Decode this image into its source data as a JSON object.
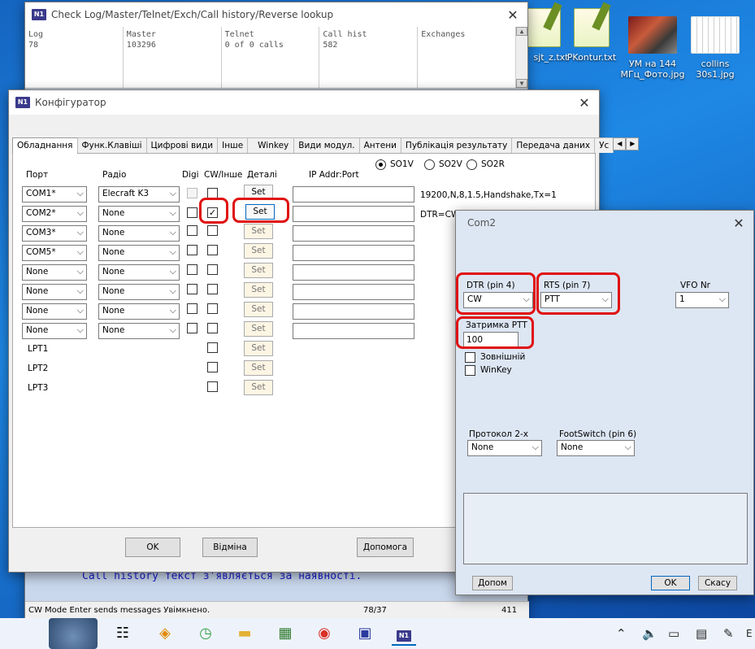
{
  "desktop_icons": [
    {
      "label": "sjt_z.txt",
      "icon": "notepad-icon"
    },
    {
      "label": "PKontur.txt",
      "icon": "notepad-icon"
    },
    {
      "label": "УМ на 144 МГц_Фото.jpg",
      "icon": "photo-icon"
    },
    {
      "label": "collins 30s1.jpg",
      "icon": "photo-icon"
    }
  ],
  "checklog": {
    "title": "Check Log/Master/Telnet/Exch/Call history/Reverse lookup",
    "columns": [
      {
        "name": "Log",
        "value": "78"
      },
      {
        "name": "Master",
        "value": "103296"
      },
      {
        "name": "Telnet",
        "value": "0 of 0 calls"
      },
      {
        "name": "Call hist",
        "value": "582"
      },
      {
        "name": "Exchanges",
        "value": ""
      }
    ],
    "info": "Call history текст з'являється за наявності.",
    "status": {
      "mode": "CW Mode Enter sends messages Увімкнено.",
      "count": "78/37",
      "num": "411"
    }
  },
  "config": {
    "title": "Конфігуратор",
    "tabs": [
      "Обладнання",
      "Функ.Клавіші",
      "Цифрові види",
      "Інше",
      "Winkey",
      "Види модул.",
      "Антени",
      "Публікація результату",
      "Передача даних",
      "Ус"
    ],
    "radios": [
      "SO1V",
      "SO2V",
      "SO2R"
    ],
    "headers": {
      "port": "Порт",
      "radio": "Радіо",
      "digi": "Digi",
      "cw": "CW/Інше",
      "details": "Деталі",
      "ip": "IP Addr:Port"
    },
    "rows": [
      {
        "port": "COM1*",
        "radio": "Elecraft K3",
        "set": "Set",
        "info": "19200,N,8,1.5,Handshake,Tx=1"
      },
      {
        "port": "COM2*",
        "radio": "None",
        "set": "Set",
        "info": "DTR=CW,RTS=PTT"
      },
      {
        "port": "COM3*",
        "radio": "None",
        "set": "Set",
        "info": ""
      },
      {
        "port": "COM5*",
        "radio": "None",
        "set": "Set",
        "info": ""
      },
      {
        "port": "None",
        "radio": "None",
        "set": "Set",
        "info": ""
      },
      {
        "port": "None",
        "radio": "None",
        "set": "Set",
        "info": ""
      },
      {
        "port": "None",
        "radio": "None",
        "set": "Set",
        "info": ""
      },
      {
        "port": "None",
        "radio": "None",
        "set": "Set",
        "info": ""
      }
    ],
    "lpt": [
      {
        "port": "LPT1",
        "set": "Set"
      },
      {
        "port": "LPT2",
        "set": "Set"
      },
      {
        "port": "LPT3",
        "set": "Set"
      }
    ],
    "buttons": {
      "ok": "OK",
      "cancel": "Відміна",
      "help": "Допомога"
    }
  },
  "com2": {
    "title": "Com2",
    "dtr_label": "DTR (pin 4)",
    "dtr_value": "CW",
    "rts_label": "RTS (pin 7)",
    "rts_value": "PTT",
    "vfo_label": "VFO Nr",
    "vfo_value": "1",
    "ptt_delay_label": "Затримка PTT",
    "ptt_delay_value": "100",
    "external_label": "Зовнішній",
    "winkey_label": "WinKey",
    "protocol_label": "Протокол 2-х",
    "protocol_value": "None",
    "footswitch_label": "FootSwitch (pin 6)",
    "footswitch_value": "None",
    "buttons": {
      "help": "Допом",
      "ok": "OK",
      "cancel": "Скасу"
    }
  },
  "taskbar": {
    "tray_lang": "E"
  },
  "colors": {
    "highlight": "#e01010",
    "accent": "#0067c0"
  }
}
